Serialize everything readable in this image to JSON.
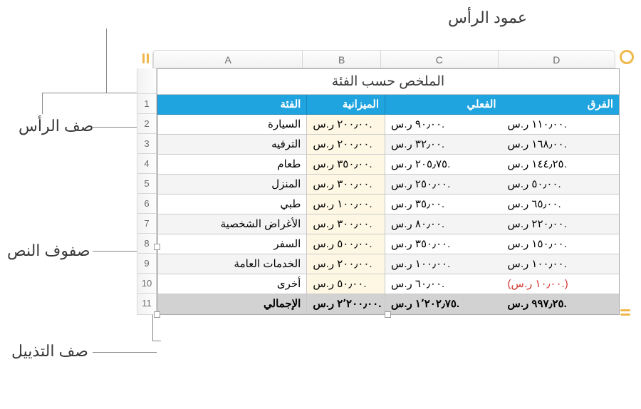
{
  "labels": {
    "header_column": "عمود الرأس",
    "header_row": "صف الرأس",
    "body_rows": "صفوف النص",
    "footer_row": "صف التذييل"
  },
  "columns": {
    "A": "A",
    "B": "B",
    "C": "C",
    "D": "D"
  },
  "rownums": [
    "1",
    "2",
    "3",
    "4",
    "5",
    "6",
    "7",
    "8",
    "9",
    "10",
    "11"
  ],
  "title": "الملخص حسب الفئة",
  "headers": {
    "category": "الفئة",
    "budget": "الميزانية",
    "actual": "الفعلي",
    "diff": "الفرق"
  },
  "rows": [
    {
      "cat": "السيارة",
      "budget": "٢٠٠٫٠٠ ر.س.",
      "actual": "٩٠٫٠٠ ر.س.",
      "diff": "١١٠٫٠٠ ر.س."
    },
    {
      "cat": "الترفيه",
      "budget": "٢٠٠٫٠٠ ر.س.",
      "actual": "٣٢٫٠٠ ر.س.",
      "diff": "١٦٨٫٠٠ ر.س."
    },
    {
      "cat": "طعام",
      "budget": "٣٥٠٫٠٠ ر.س.",
      "actual": "٢٠٥٫٧٥ ر.س.",
      "diff": "١٤٤٫٢٥ ر.س."
    },
    {
      "cat": "المنزل",
      "budget": "٣٠٠٫٠٠ ر.س.",
      "actual": "٢٥٠٫٠٠ ر.س.",
      "diff": "٥٠٫٠٠ ر.س."
    },
    {
      "cat": "طبي",
      "budget": "١٠٠٫٠٠ ر.س.",
      "actual": "٣٥٫٠٠ ر.س.",
      "diff": "٦٥٫٠٠ ر.س."
    },
    {
      "cat": "الأغراض الشخصية",
      "budget": "٣٠٠٫٠٠ ر.س.",
      "actual": "٨٠٫٠٠ ر.س.",
      "diff": "٢٢٠٫٠٠ ر.س."
    },
    {
      "cat": "السفر",
      "budget": "٥٠٠٫٠٠ ر.س.",
      "actual": "٣٥٠٫٠٠ ر.س.",
      "diff": "١٥٠٫٠٠ ر.س."
    },
    {
      "cat": "الخدمات العامة",
      "budget": "٢٠٠٫٠٠ ر.س.",
      "actual": "١٠٠٫٠٠ ر.س.",
      "diff": "١٠٠٫٠٠ ر.س."
    },
    {
      "cat": "أخرى",
      "budget": "٥٠٫٠٠ ر.س.",
      "actual": "٦٠٫٠٠ ر.س.",
      "diff": "(١٠٫٠٠ ر.س.)",
      "neg": true
    }
  ],
  "footer": {
    "label": "الإجمالي",
    "budget": "٢٬٢٠٠٫٠٠ ر.س.",
    "actual": "١٬٢٠٢٫٧٥ ر.س.",
    "diff": "٩٩٧٫٢٥ ر.س."
  }
}
